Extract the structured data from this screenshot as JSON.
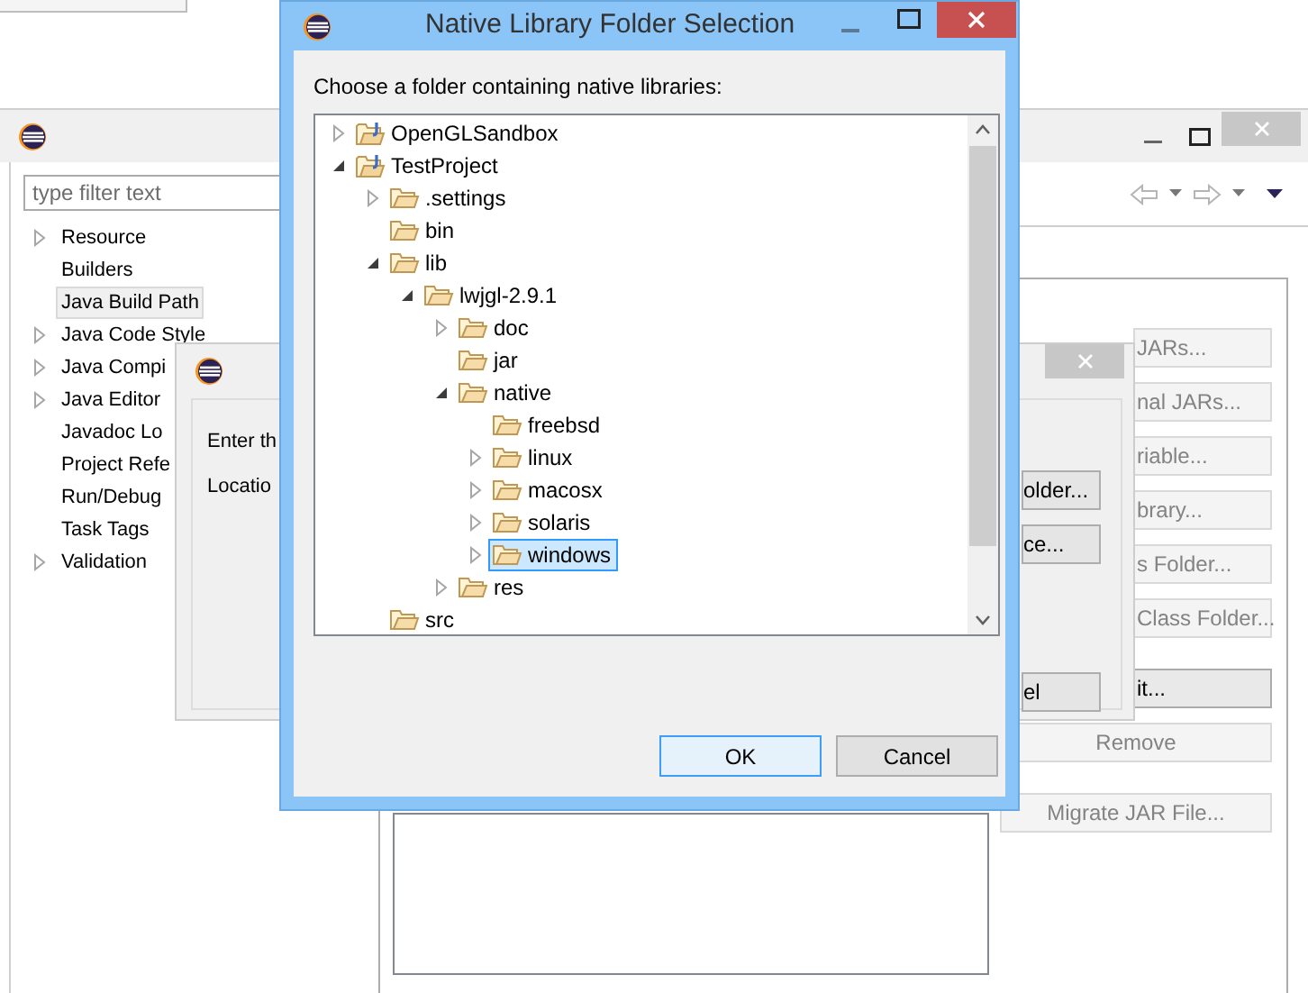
{
  "properties_window": {
    "filter": {
      "placeholder": "type filter text"
    },
    "categories": [
      {
        "label": "Resource",
        "has_children": true,
        "selected": false
      },
      {
        "label": "Builders",
        "has_children": false,
        "selected": false
      },
      {
        "label": "Java Build Path",
        "has_children": false,
        "selected": true
      },
      {
        "label": "Java Code Style",
        "has_children": true,
        "selected": false
      },
      {
        "label": "Java Compi",
        "has_children": true,
        "selected": false
      },
      {
        "label": "Java Editor",
        "has_children": true,
        "selected": false
      },
      {
        "label": "Javadoc Lo",
        "has_children": false,
        "selected": false
      },
      {
        "label": "Project Refe",
        "has_children": false,
        "selected": false
      },
      {
        "label": "Run/Debug",
        "has_children": false,
        "selected": false
      },
      {
        "label": "Task Tags",
        "has_children": false,
        "selected": false
      },
      {
        "label": "Validation",
        "has_children": true,
        "selected": false
      }
    ],
    "buttons": [
      {
        "label": "JARs...",
        "disabled": true
      },
      {
        "label": "nal JARs...",
        "disabled": true
      },
      {
        "label": "riable...",
        "disabled": true
      },
      {
        "label": "brary...",
        "disabled": true
      },
      {
        "label": "s Folder...",
        "disabled": true
      },
      {
        "label": "Class Folder...",
        "disabled": true
      },
      {
        "label": "it...",
        "disabled": false
      },
      {
        "label": "Remove",
        "disabled": true
      },
      {
        "label": "Migrate JAR File...",
        "disabled": true
      }
    ]
  },
  "hidden_dialog": {
    "texts": [
      "Enter th",
      "Locatio"
    ],
    "buttons": [
      {
        "label": "older..."
      },
      {
        "label": "ce..."
      },
      {
        "label": "el"
      }
    ]
  },
  "folder_dialog": {
    "title": "Native Library Folder Selection",
    "prompt": "Choose a folder containing native libraries:",
    "tree": [
      {
        "label": "OpenGLSandbox",
        "kind": "project",
        "has_children": true,
        "selected": false
      },
      {
        "label": "TestProject",
        "kind": "project",
        "has_children": true,
        "selected": false,
        "children": [
          {
            "label": ".settings",
            "kind": "folder",
            "has_children": true,
            "selected": false
          },
          {
            "label": "bin",
            "kind": "folder",
            "has_children": false,
            "selected": false
          },
          {
            "label": "lib",
            "kind": "folder",
            "has_children": true,
            "selected": false,
            "children": [
              {
                "label": "lwjgl-2.9.1",
                "kind": "folder",
                "has_children": true,
                "selected": false,
                "children": [
                  {
                    "label": "doc",
                    "kind": "folder",
                    "has_children": true,
                    "selected": false
                  },
                  {
                    "label": "jar",
                    "kind": "folder",
                    "has_children": false,
                    "selected": false
                  },
                  {
                    "label": "native",
                    "kind": "folder",
                    "has_children": true,
                    "selected": false,
                    "children": [
                      {
                        "label": "freebsd",
                        "kind": "folder",
                        "has_children": false,
                        "selected": false
                      },
                      {
                        "label": "linux",
                        "kind": "folder",
                        "has_children": true,
                        "selected": false
                      },
                      {
                        "label": "macosx",
                        "kind": "folder",
                        "has_children": true,
                        "selected": false
                      },
                      {
                        "label": "solaris",
                        "kind": "folder",
                        "has_children": true,
                        "selected": false
                      },
                      {
                        "label": "windows",
                        "kind": "folder",
                        "has_children": true,
                        "selected": true
                      }
                    ]
                  },
                  {
                    "label": "res",
                    "kind": "folder",
                    "has_children": true,
                    "selected": false
                  }
                ]
              }
            ]
          },
          {
            "label": "src",
            "kind": "folder",
            "has_children": false,
            "selected": false
          }
        ]
      }
    ],
    "buttons": [
      {
        "label": "OK",
        "focused": true
      },
      {
        "label": "Cancel",
        "focused": false
      }
    ]
  }
}
